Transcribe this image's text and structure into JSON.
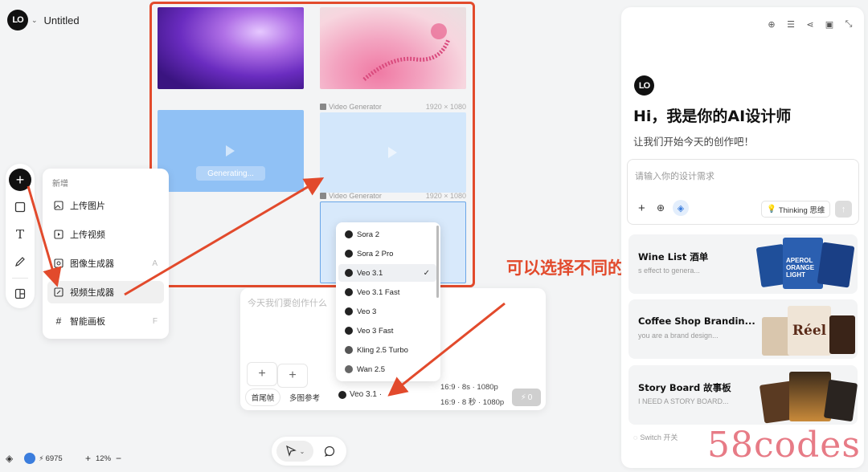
{
  "app": {
    "title": "Untitled",
    "logo_text": "LO"
  },
  "left_toolbar": {
    "tools": [
      "add-icon",
      "square-icon",
      "text-icon",
      "pen-icon",
      "layout-icon"
    ]
  },
  "add_menu": {
    "title": "新增",
    "items": [
      {
        "label": "上传图片",
        "shortcut": ""
      },
      {
        "label": "上传视频",
        "shortcut": ""
      },
      {
        "label": "图像生成器",
        "shortcut": "A"
      },
      {
        "label": "视频生成器",
        "shortcut": ""
      },
      {
        "label": "智能画板",
        "shortcut": "F"
      }
    ]
  },
  "canvas": {
    "generating_label": "Generating...",
    "video_frames": [
      {
        "label": "Video Generator",
        "size": "1920 × 1080"
      },
      {
        "label": "Video Generator",
        "size": "1920 × 1080"
      }
    ]
  },
  "prompt": {
    "placeholder": "今天我们要创作什么",
    "pills": [
      "首尾帧",
      "多图参考"
    ],
    "model_selected": "Veo 3.1 ·",
    "spec_line1": "16:9 · 8s · 1080p",
    "spec_line2": "16:9 · 8 秒 · 1080p",
    "send_label": "0"
  },
  "model_dropdown": {
    "options": [
      "Sora 2",
      "Sora 2 Pro",
      "Veo 3.1",
      "Veo 3.1 Fast",
      "Veo 3",
      "Veo 3 Fast",
      "Kling 2.5 Turbo",
      "Wan 2.5"
    ],
    "selected": "Veo 3.1"
  },
  "annotation": {
    "text": "可以选择不同的模型"
  },
  "assistant_panel": {
    "greeting": "Hi，我是你的AI设计师",
    "subtitle": "让我们开始今天的创作吧！",
    "input_placeholder": "请输入你的设计需求",
    "thinking_label": "Thinking 思维",
    "cards": [
      {
        "title": "Wine List  酒单",
        "desc": "s effect to genera..."
      },
      {
        "title": "Coffee Shop Brandin...",
        "desc": "you are a brand design..."
      },
      {
        "title": "Story Board  故事板",
        "desc": "I NEED A STORY BOARD..."
      }
    ],
    "switch_label": "Switch  开关",
    "card_art_text": {
      "wine": [
        "APEROL",
        "ORANGE",
        "LIGHT"
      ],
      "coffee": "Réel"
    }
  },
  "bottom_bar": {
    "credits": "6975",
    "zoom": "12%"
  },
  "watermark": "58codes",
  "colors": {
    "accent_red": "#e24a2c",
    "blue_selection": "#6aa6e8",
    "generating_blue": "#90c1f5"
  }
}
